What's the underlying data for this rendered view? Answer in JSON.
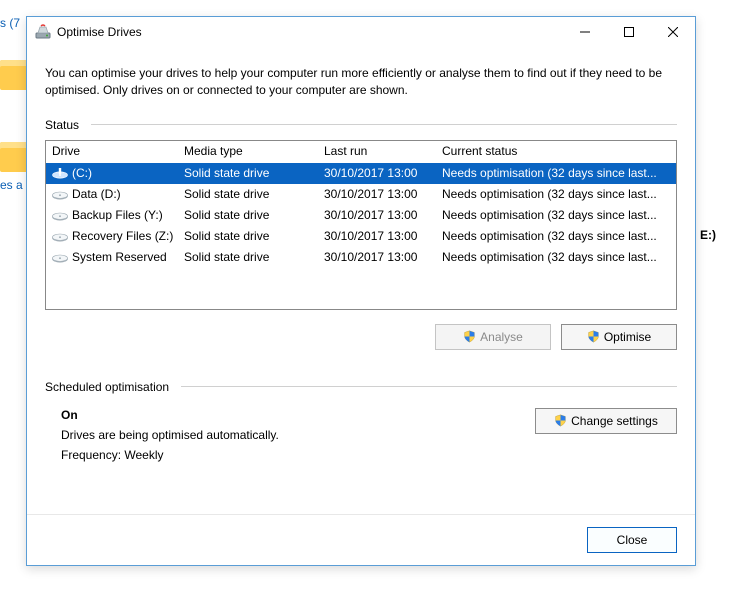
{
  "window": {
    "title": "Optimise Drives"
  },
  "intro": "You can optimise your drives to help your computer run more efficiently or analyse them to find out if they need to be optimised. Only drives on or connected to your computer are shown.",
  "status_label": "Status",
  "columns": {
    "drive": "Drive",
    "media": "Media type",
    "last": "Last run",
    "status": "Current status"
  },
  "rows": [
    {
      "name": "(C:)",
      "media": "Solid state drive",
      "last": "30/10/2017 13:00",
      "status": "Needs optimisation (32 days since last...",
      "selected": true,
      "primary": true
    },
    {
      "name": "Data (D:)",
      "media": "Solid state drive",
      "last": "30/10/2017 13:00",
      "status": "Needs optimisation (32 days since last..."
    },
    {
      "name": "Backup Files (Y:)",
      "media": "Solid state drive",
      "last": "30/10/2017 13:00",
      "status": "Needs optimisation (32 days since last..."
    },
    {
      "name": "Recovery Files (Z:)",
      "media": "Solid state drive",
      "last": "30/10/2017 13:00",
      "status": "Needs optimisation (32 days since last..."
    },
    {
      "name": "System Reserved",
      "media": "Solid state drive",
      "last": "30/10/2017 13:00",
      "status": "Needs optimisation (32 days since last..."
    }
  ],
  "buttons": {
    "analyse": "Analyse",
    "optimise": "Optimise",
    "change_settings": "Change settings",
    "close": "Close"
  },
  "scheduled": {
    "label": "Scheduled optimisation",
    "state": "On",
    "desc": "Drives are being optimised automatically.",
    "freq": "Frequency: Weekly"
  },
  "bg": {
    "left_text_top": "s (7",
    "left_text_mid": "es a",
    "left_text_right": "E:)"
  }
}
